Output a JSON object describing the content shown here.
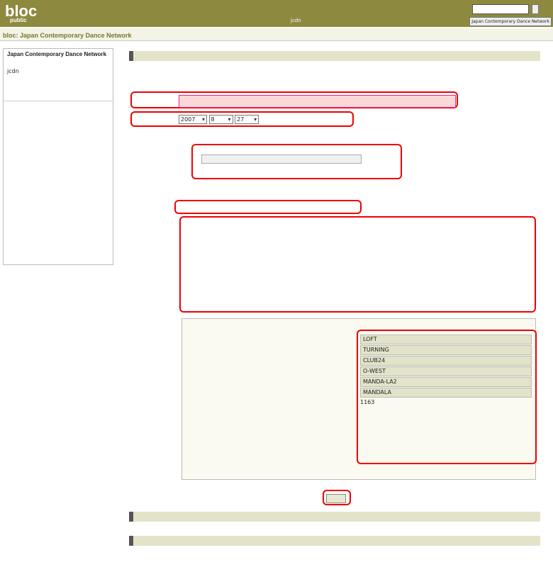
{
  "header": {
    "logo": "bloc",
    "sub": "public",
    "search_button": "",
    "toolbar": [
      "Japan Contemporary Dance Network",
      "",
      "",
      "",
      "",
      ""
    ]
  },
  "user": {
    "id": "jcdn"
  },
  "site": {
    "name": "bloc: Japan Contemporary Dance Network"
  },
  "sidebar": {
    "org": "Japan Contemporary Dance Network",
    "uid": "jcdn"
  },
  "form": {
    "year": "2007",
    "month": "8",
    "day": "27"
  },
  "bloc": {
    "items": [
      "",
      "LOFT",
      "",
      "TURNING",
      "CLUB24",
      "",
      "O-WEST",
      "",
      "MANDA-LA2",
      "MANDALA"
    ],
    "count": "1163"
  }
}
